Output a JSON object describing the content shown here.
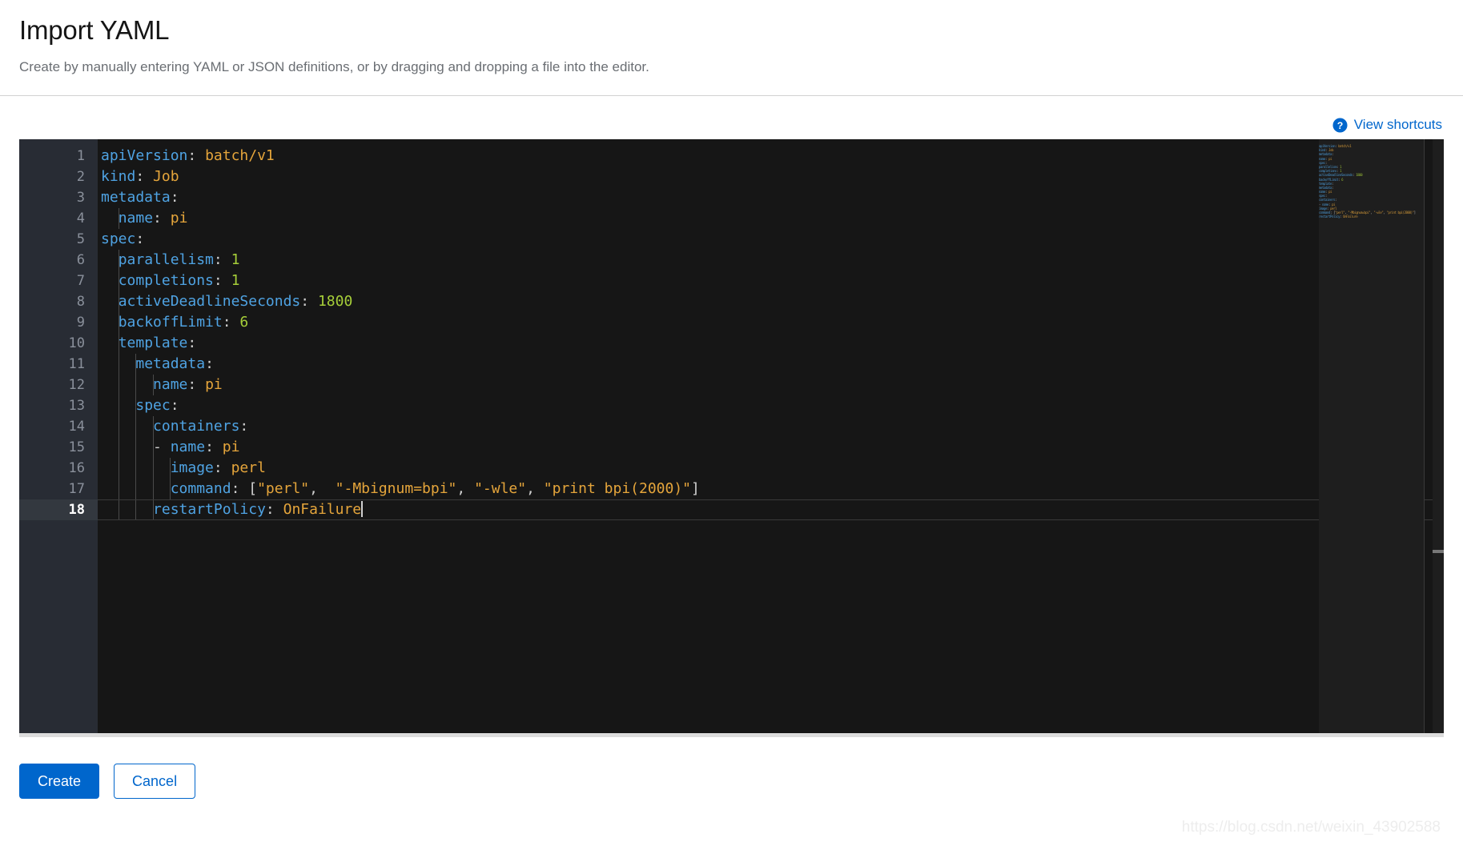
{
  "header": {
    "title": "Import YAML",
    "subtitle": "Create by manually entering YAML or JSON definitions, or by dragging and dropping a file into the editor."
  },
  "toolbar": {
    "shortcuts_label": "View shortcuts",
    "help_icon": "question-circle-icon"
  },
  "editor": {
    "language": "yaml",
    "active_line": 18,
    "cursor_line": 18,
    "cursor_column": 30,
    "line_numbers": [
      1,
      2,
      3,
      4,
      5,
      6,
      7,
      8,
      9,
      10,
      11,
      12,
      13,
      14,
      15,
      16,
      17,
      18
    ],
    "lines": [
      {
        "n": 1,
        "text": "apiVersion: batch/v1"
      },
      {
        "n": 2,
        "text": "kind: Job"
      },
      {
        "n": 3,
        "text": "metadata:"
      },
      {
        "n": 4,
        "text": "  name: pi"
      },
      {
        "n": 5,
        "text": "spec:"
      },
      {
        "n": 6,
        "text": "  parallelism: 1"
      },
      {
        "n": 7,
        "text": "  completions: 1"
      },
      {
        "n": 8,
        "text": "  activeDeadlineSeconds: 1800"
      },
      {
        "n": 9,
        "text": "  backoffLimit: 6"
      },
      {
        "n": 10,
        "text": "  template:"
      },
      {
        "n": 11,
        "text": "    metadata:"
      },
      {
        "n": 12,
        "text": "      name: pi"
      },
      {
        "n": 13,
        "text": "    spec:"
      },
      {
        "n": 14,
        "text": "      containers:"
      },
      {
        "n": 15,
        "text": "      - name: pi"
      },
      {
        "n": 16,
        "text": "        image: perl"
      },
      {
        "n": 17,
        "text": "        command: [\"perl\",  \"-Mbignum=bpi\", \"-wle\", \"print bpi(2000)\"]"
      },
      {
        "n": 18,
        "text": "      restartPolicy: OnFailure"
      }
    ],
    "colors": {
      "background": "#161616",
      "gutter_background": "#282c34",
      "gutter_text": "#8a909b",
      "gutter_text_active": "#ffffff",
      "key": "#4fa3e3",
      "string": "#e5a53b",
      "number": "#a6ce39",
      "punctuation": "#cfcfcf",
      "minimap_background": "#1e1e1e"
    }
  },
  "footer": {
    "create_label": "Create",
    "cancel_label": "Cancel",
    "primary_color": "#0066cc"
  },
  "watermark": {
    "text": "https://blog.csdn.net/weixin_43902588"
  }
}
